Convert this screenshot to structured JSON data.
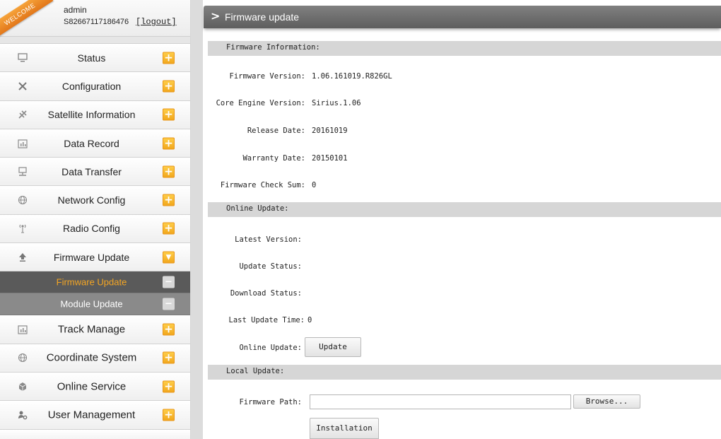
{
  "user": {
    "welcome_text": "WELCOME",
    "name": "admin",
    "serial": "S82667117186476",
    "logout_label": "[logout]"
  },
  "sidebar": {
    "items": [
      {
        "label": "Status",
        "icon": "monitor-icon",
        "toggle": "+"
      },
      {
        "label": "Configuration",
        "icon": "tools-icon",
        "toggle": "+"
      },
      {
        "label": "Satellite Information",
        "icon": "satellite-icon",
        "toggle": "+"
      },
      {
        "label": "Data Record",
        "icon": "calendar-icon",
        "toggle": "+"
      },
      {
        "label": "Data Transfer",
        "icon": "network-box-icon",
        "toggle": "+"
      },
      {
        "label": "Network Config",
        "icon": "globe-icon",
        "toggle": "+"
      },
      {
        "label": "Radio Config",
        "icon": "antenna-icon",
        "toggle": "+"
      },
      {
        "label": "Firmware Update",
        "icon": "upload-icon",
        "toggle": "▼"
      },
      {
        "label": "Track Manage",
        "icon": "calendar-icon",
        "toggle": "+"
      },
      {
        "label": "Coordinate System",
        "icon": "globe-icon",
        "toggle": "+"
      },
      {
        "label": "Online Service",
        "icon": "cube-icon",
        "toggle": "+"
      },
      {
        "label": "User Management",
        "icon": "user-gear-icon",
        "toggle": "+"
      }
    ],
    "subitems": [
      {
        "label": "Firmware Update",
        "toggle": "−",
        "active": true
      },
      {
        "label": "Module Update",
        "toggle": "−",
        "active": false
      }
    ]
  },
  "header": {
    "title": "Firmware update"
  },
  "firmware_info": {
    "section_title": "Firmware Information:",
    "fields": [
      {
        "label": "Firmware Version:",
        "value": "1.06.161019.R826GL"
      },
      {
        "label": "Core Engine Version:",
        "value": "Sirius.1.06"
      },
      {
        "label": "Release Date:",
        "value": "20161019"
      },
      {
        "label": "Warranty Date:",
        "value": "20150101"
      },
      {
        "label": "Firmware Check Sum:",
        "value": "0"
      }
    ]
  },
  "online_update": {
    "section_title": "Online Update:",
    "fields": [
      {
        "label": "Latest Version:",
        "value": ""
      },
      {
        "label": "Update Status:",
        "value": ""
      },
      {
        "label": "Download Status:",
        "value": ""
      },
      {
        "label": "Last Update Time:",
        "value": "0"
      },
      {
        "label": "Online Update:",
        "value": ""
      }
    ],
    "update_button": "Update"
  },
  "local_update": {
    "section_title": "Local Update:",
    "path_label": "Firmware Path:",
    "path_value": "",
    "browse_button": "Browse...",
    "install_button": "Installation"
  },
  "colors": {
    "accent": "#f1a51a",
    "header_bg": "#6e6e6e",
    "active_sub_text": "#f5a623"
  }
}
